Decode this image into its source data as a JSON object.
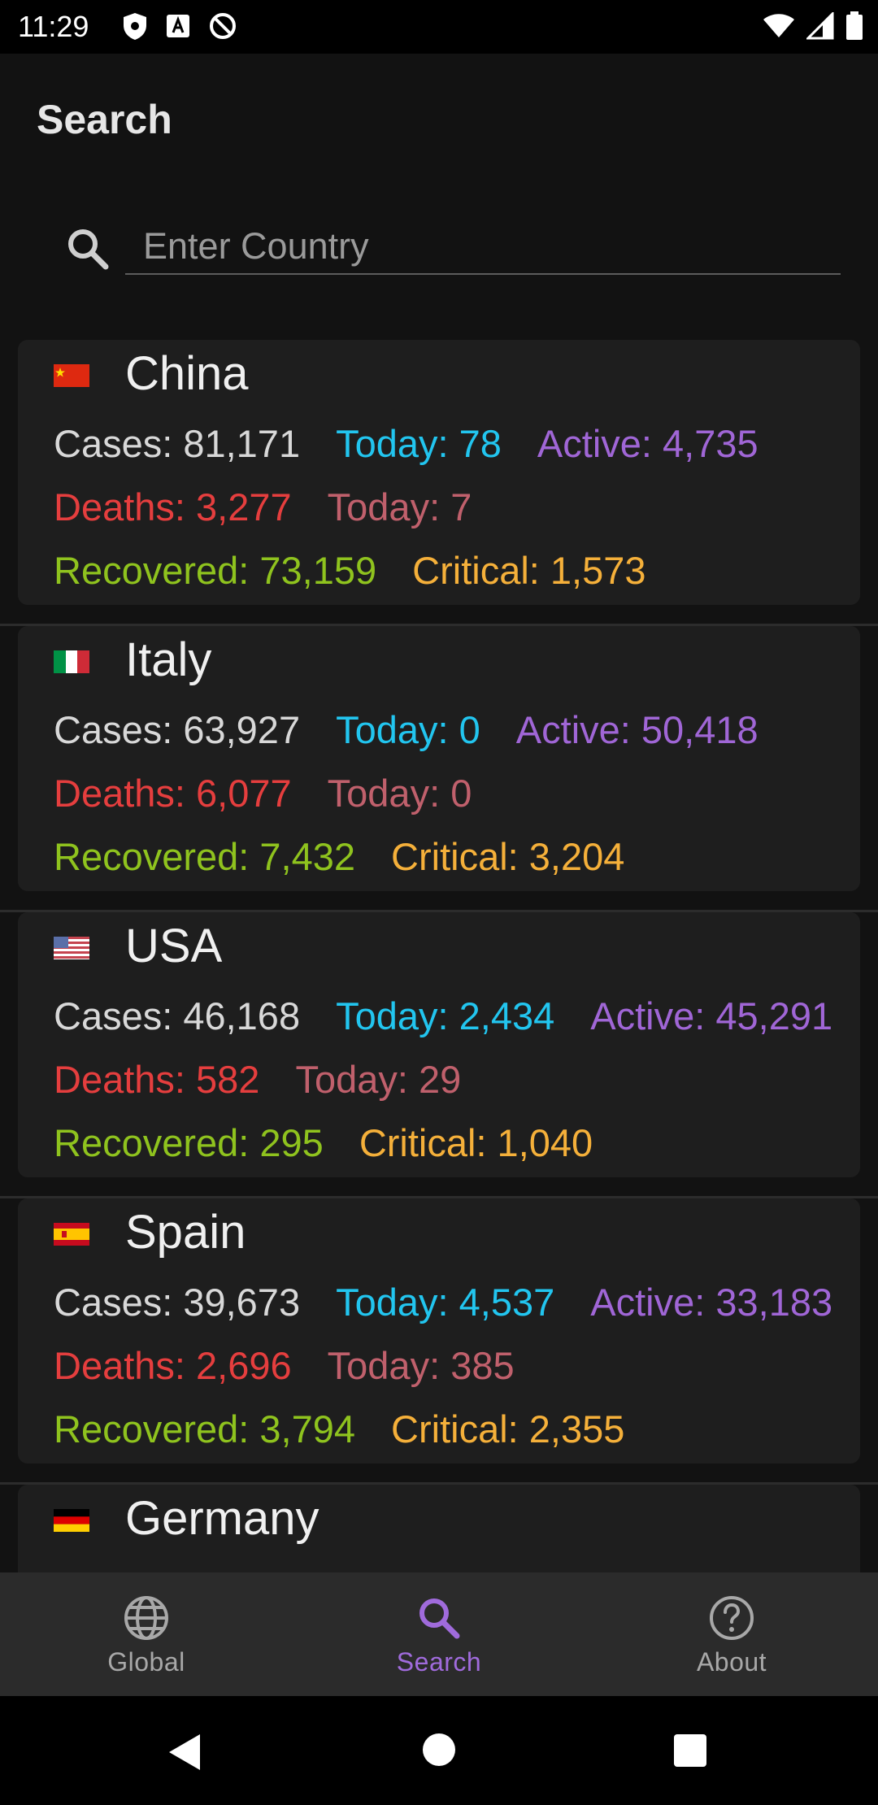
{
  "status_bar": {
    "time": "11:29"
  },
  "app_bar": {
    "title": "Search"
  },
  "search": {
    "placeholder": "Enter Country",
    "value": ""
  },
  "countries": [
    {
      "name": "China",
      "flag": "china-flag",
      "cases": "Cases: 81,171",
      "today": "Today: 78",
      "active": "Active: 4,735",
      "deaths": "Deaths: 3,277",
      "deaths_today": "Today: 7",
      "recovered": "Recovered: 73,159",
      "critical": "Critical: 1,573"
    },
    {
      "name": "Italy",
      "flag": "italy-flag",
      "cases": "Cases: 63,927",
      "today": "Today: 0",
      "active": "Active: 50,418",
      "deaths": "Deaths: 6,077",
      "deaths_today": "Today: 0",
      "recovered": "Recovered: 7,432",
      "critical": "Critical: 3,204"
    },
    {
      "name": "USA",
      "flag": "usa-flag",
      "cases": "Cases: 46,168",
      "today": "Today: 2,434",
      "active": "Active: 45,291",
      "deaths": "Deaths: 582",
      "deaths_today": "Today: 29",
      "recovered": "Recovered: 295",
      "critical": "Critical: 1,040"
    },
    {
      "name": "Spain",
      "flag": "spain-flag",
      "cases": "Cases: 39,673",
      "today": "Today: 4,537",
      "active": "Active: 33,183",
      "deaths": "Deaths: 2,696",
      "deaths_today": "Today: 385",
      "recovered": "Recovered: 3,794",
      "critical": "Critical: 2,355"
    },
    {
      "name": "Germany",
      "flag": "germany-flag"
    }
  ],
  "bottom_nav": {
    "items": [
      {
        "label": "Global",
        "icon": "globe-icon"
      },
      {
        "label": "Search",
        "icon": "search-icon"
      },
      {
        "label": "About",
        "icon": "help-icon"
      }
    ],
    "active": "Search"
  },
  "colors": {
    "background": "#121212",
    "card": "#1e1e1e",
    "today": "#22c5ef",
    "active": "#a066d6",
    "deaths": "#e53e3e",
    "deaths_today": "#c0606c",
    "recovered": "#8fc31e",
    "critical": "#f5b03a",
    "accent": "#a06bdc"
  }
}
